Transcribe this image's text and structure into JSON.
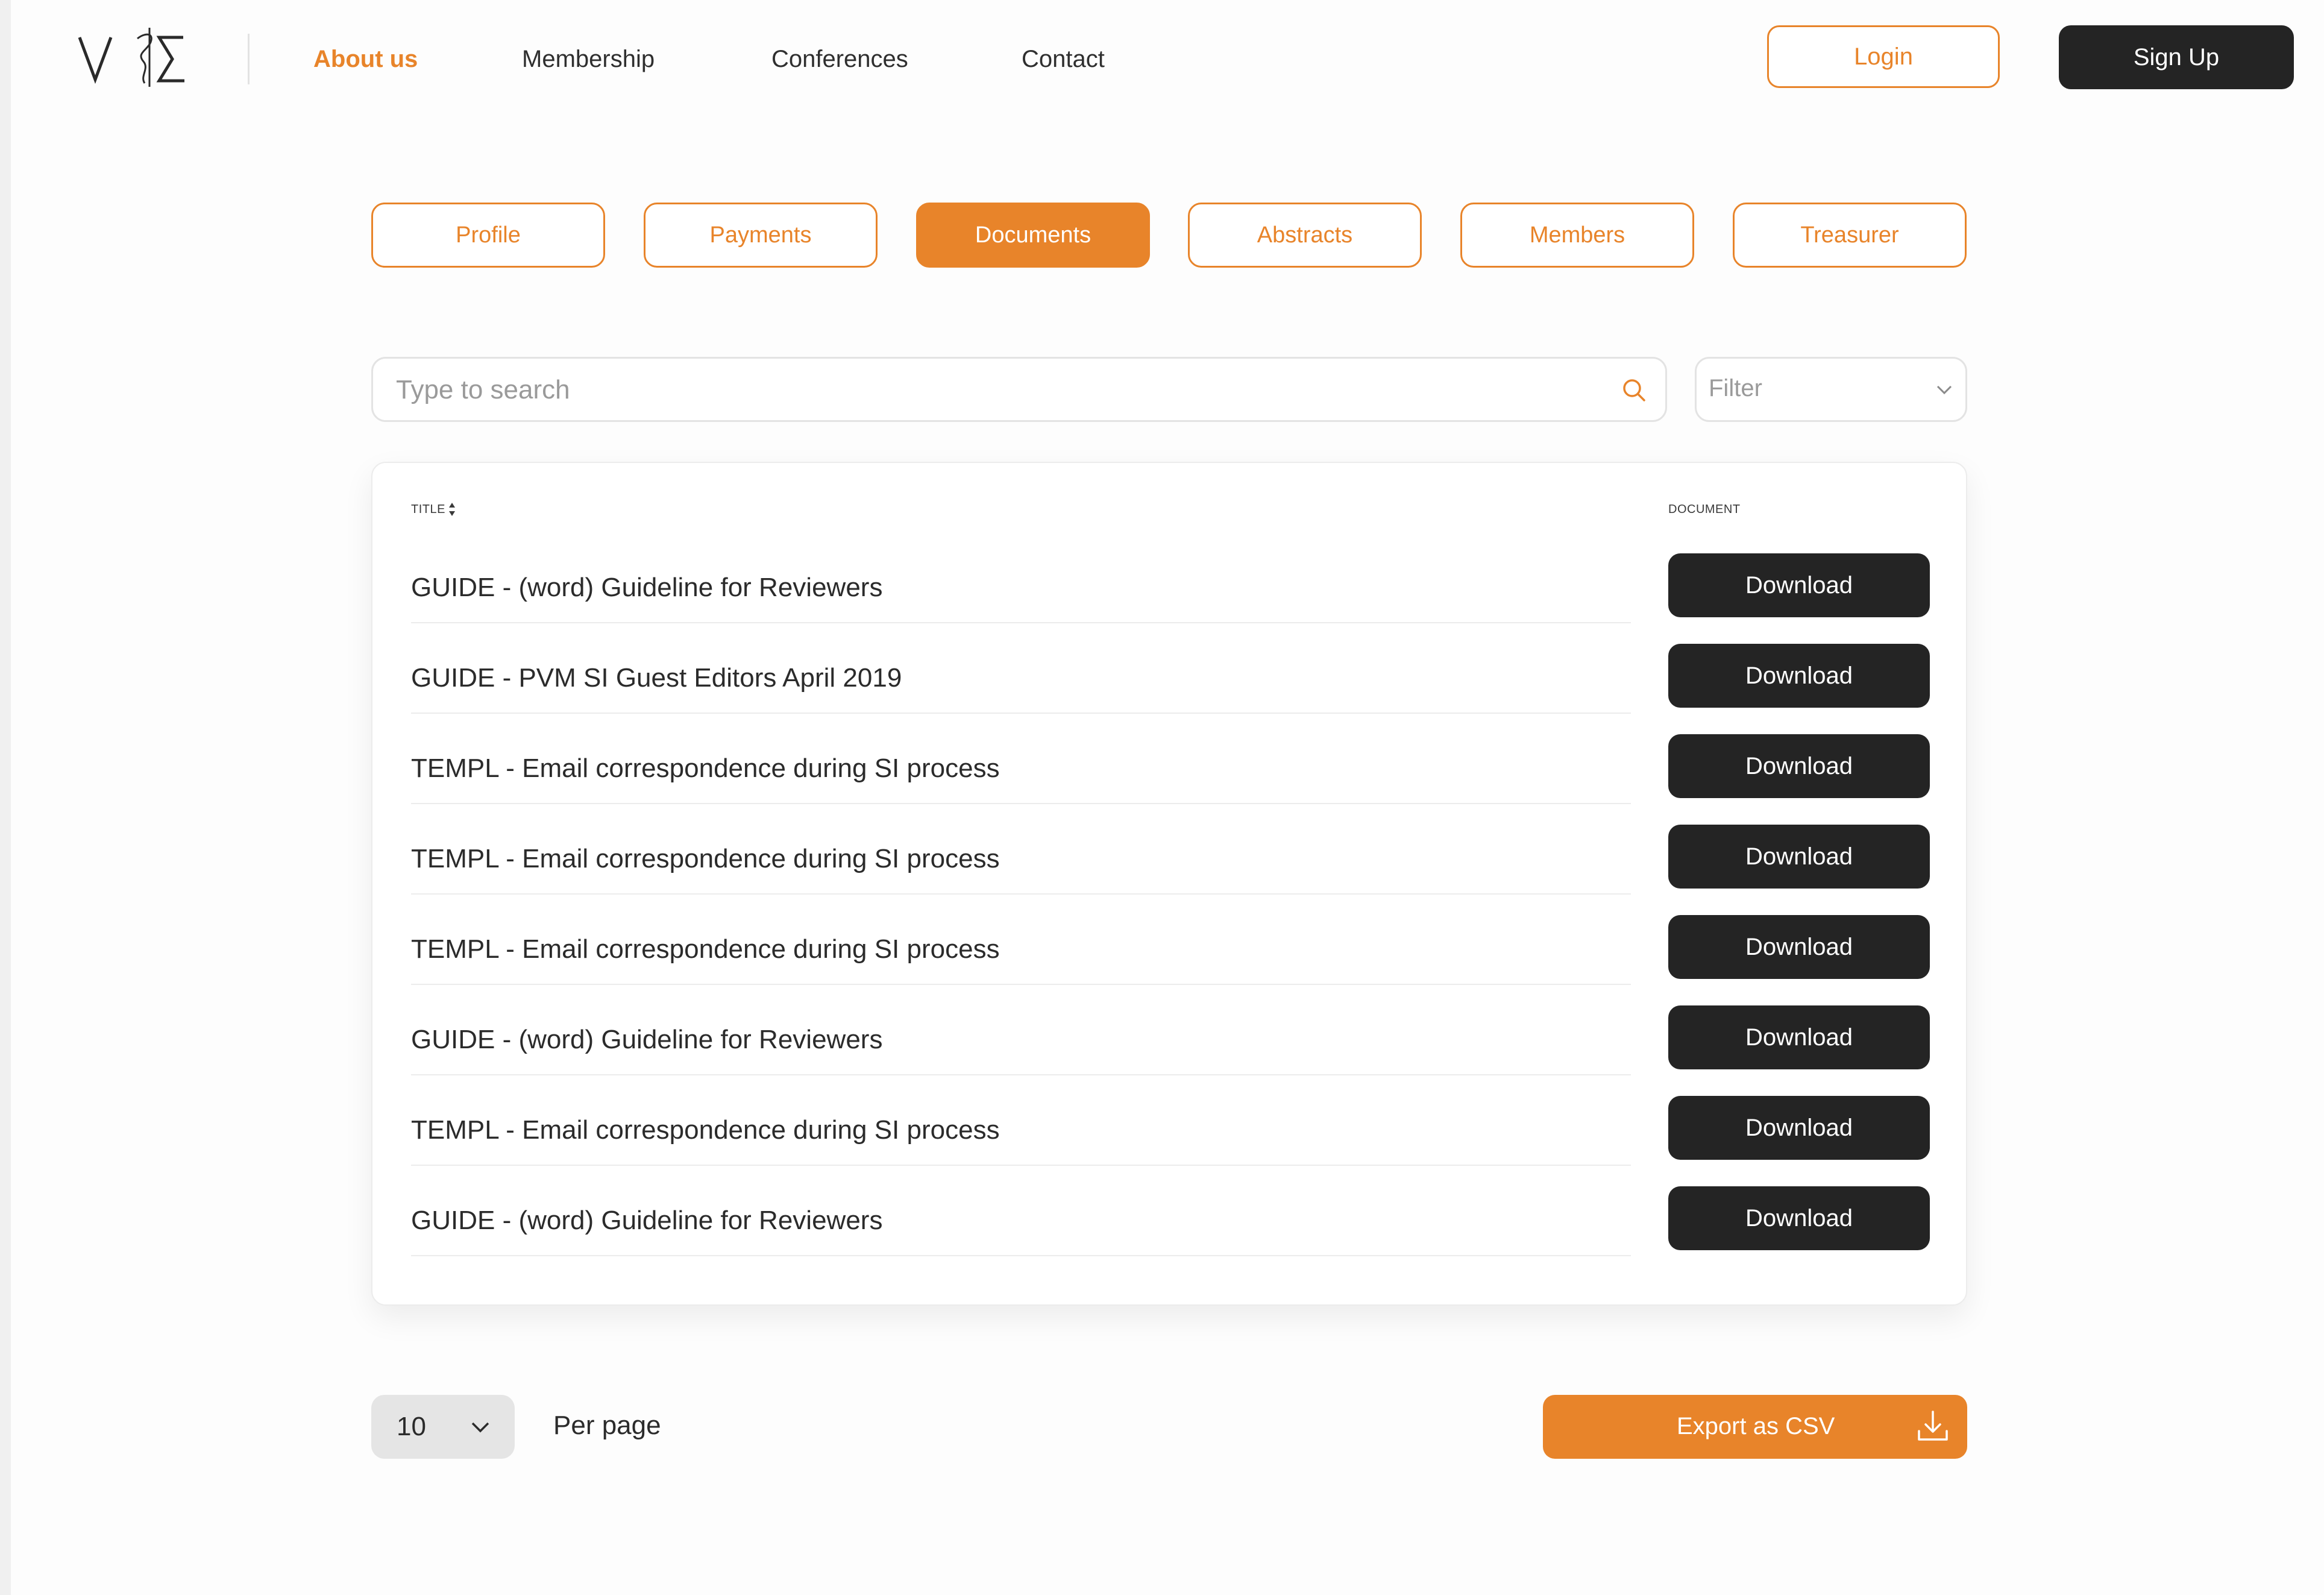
{
  "header": {
    "logo_alt": "VΣ logo",
    "nav": [
      {
        "label": "About us",
        "active": true
      },
      {
        "label": "Membership",
        "active": false
      },
      {
        "label": "Conferences",
        "active": false
      },
      {
        "label": "Contact",
        "active": false
      }
    ],
    "login_label": "Login",
    "signup_label": "Sign Up"
  },
  "tabs": [
    {
      "label": "Profile",
      "active": false
    },
    {
      "label": "Payments",
      "active": false
    },
    {
      "label": "Documents",
      "active": true
    },
    {
      "label": "Abstracts",
      "active": false
    },
    {
      "label": "Members",
      "active": false
    },
    {
      "label": "Treasurer",
      "active": false
    }
  ],
  "search": {
    "placeholder": "Type to search",
    "value": ""
  },
  "filter": {
    "placeholder": "Filter"
  },
  "table": {
    "columns": {
      "title": "TITLE",
      "document": "DOCUMENT"
    },
    "rows": [
      {
        "title": "GUIDE - (word) Guideline for Reviewers",
        "action": "Download"
      },
      {
        "title": "GUIDE - PVM SI Guest Editors April 2019",
        "action": "Download"
      },
      {
        "title": "TEMPL - Email correspondence during SI process",
        "action": "Download"
      },
      {
        "title": "TEMPL - Email correspondence during SI process",
        "action": "Download"
      },
      {
        "title": "TEMPL - Email correspondence during SI process",
        "action": "Download"
      },
      {
        "title": "GUIDE - (word) Guideline for Reviewers",
        "action": "Download"
      },
      {
        "title": "TEMPL - Email correspondence during SI process",
        "action": "Download"
      },
      {
        "title": "GUIDE - (word) Guideline for Reviewers",
        "action": "Download"
      }
    ]
  },
  "pagination": {
    "per_page_value": "10",
    "per_page_label": "Per page"
  },
  "export": {
    "label": "Export as CSV"
  },
  "colors": {
    "accent": "#e8842a",
    "dark": "#242424",
    "border": "#e3e3e3"
  },
  "icons": {
    "search": "search-icon",
    "filter_chevron": "chevron-down-icon",
    "sort": "sort-icon",
    "export": "download-icon"
  }
}
